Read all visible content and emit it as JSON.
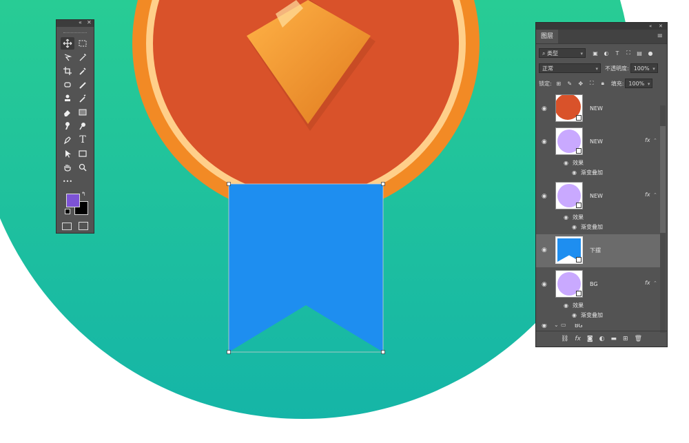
{
  "colors": {
    "background_gradient_top": "#2fd68c",
    "background_gradient_bottom": "#18b9a4",
    "medal_outer": "#f28a25",
    "medal_ring": "#ffcf8a",
    "medal_inner": "#d9522a",
    "diamond": "#f39a2c",
    "ribbon": "#1e8ef0",
    "foreground_swatch": "#7d53d6",
    "background_swatch": "#000000",
    "panel_bg": "#535353"
  },
  "tools_panel": {
    "icons": [
      "move-icon",
      "marquee-icon",
      "lasso-icon",
      "magic-wand-icon",
      "crop-icon",
      "eyedropper-icon",
      "healing-icon",
      "brush-icon",
      "stamp-icon",
      "history-brush-icon",
      "eraser-icon",
      "gradient-icon",
      "blur-icon",
      "dodge-icon",
      "pen-icon",
      "type-icon",
      "path-select-icon",
      "rectangle-icon",
      "hand-icon",
      "zoom-icon",
      "more-icon"
    ],
    "type_glyph": "T",
    "more_glyph": "•••"
  },
  "layers_panel": {
    "tab_label": "图层",
    "filter_label": "类型",
    "blend_mode": "正常",
    "opacity_label": "不透明度:",
    "opacity_value": "100%",
    "lock_label": "锁定:",
    "fill_label": "填充:",
    "fill_value": "100%",
    "layers": [
      {
        "name": "NEW",
        "thumb_color": "#d9522a",
        "fx": "",
        "effects": []
      },
      {
        "name": "NEW",
        "thumb_color": "#c9a9ff",
        "fx": "fx",
        "effects_label": "效果",
        "effect": "渐变叠加"
      },
      {
        "name": "NEW",
        "thumb_color": "#c9a9ff",
        "fx": "fx",
        "effects_label": "效果",
        "effect": "渐变叠加"
      },
      {
        "name": "下摆",
        "thumb_color": "#1e8ef0",
        "fx": "",
        "effects": []
      },
      {
        "name": "BG",
        "thumb_color": "#c9a9ff",
        "fx": "fx",
        "effects_label": "效果",
        "effect": "渐变叠加"
      },
      {
        "name": "BG",
        "group": true
      }
    ],
    "bottom_icons": [
      "link-icon",
      "fx-icon",
      "mask-icon",
      "adjustment-icon",
      "folder-icon",
      "new-layer-icon",
      "trash-icon"
    ],
    "fx_glyph": "fx"
  }
}
